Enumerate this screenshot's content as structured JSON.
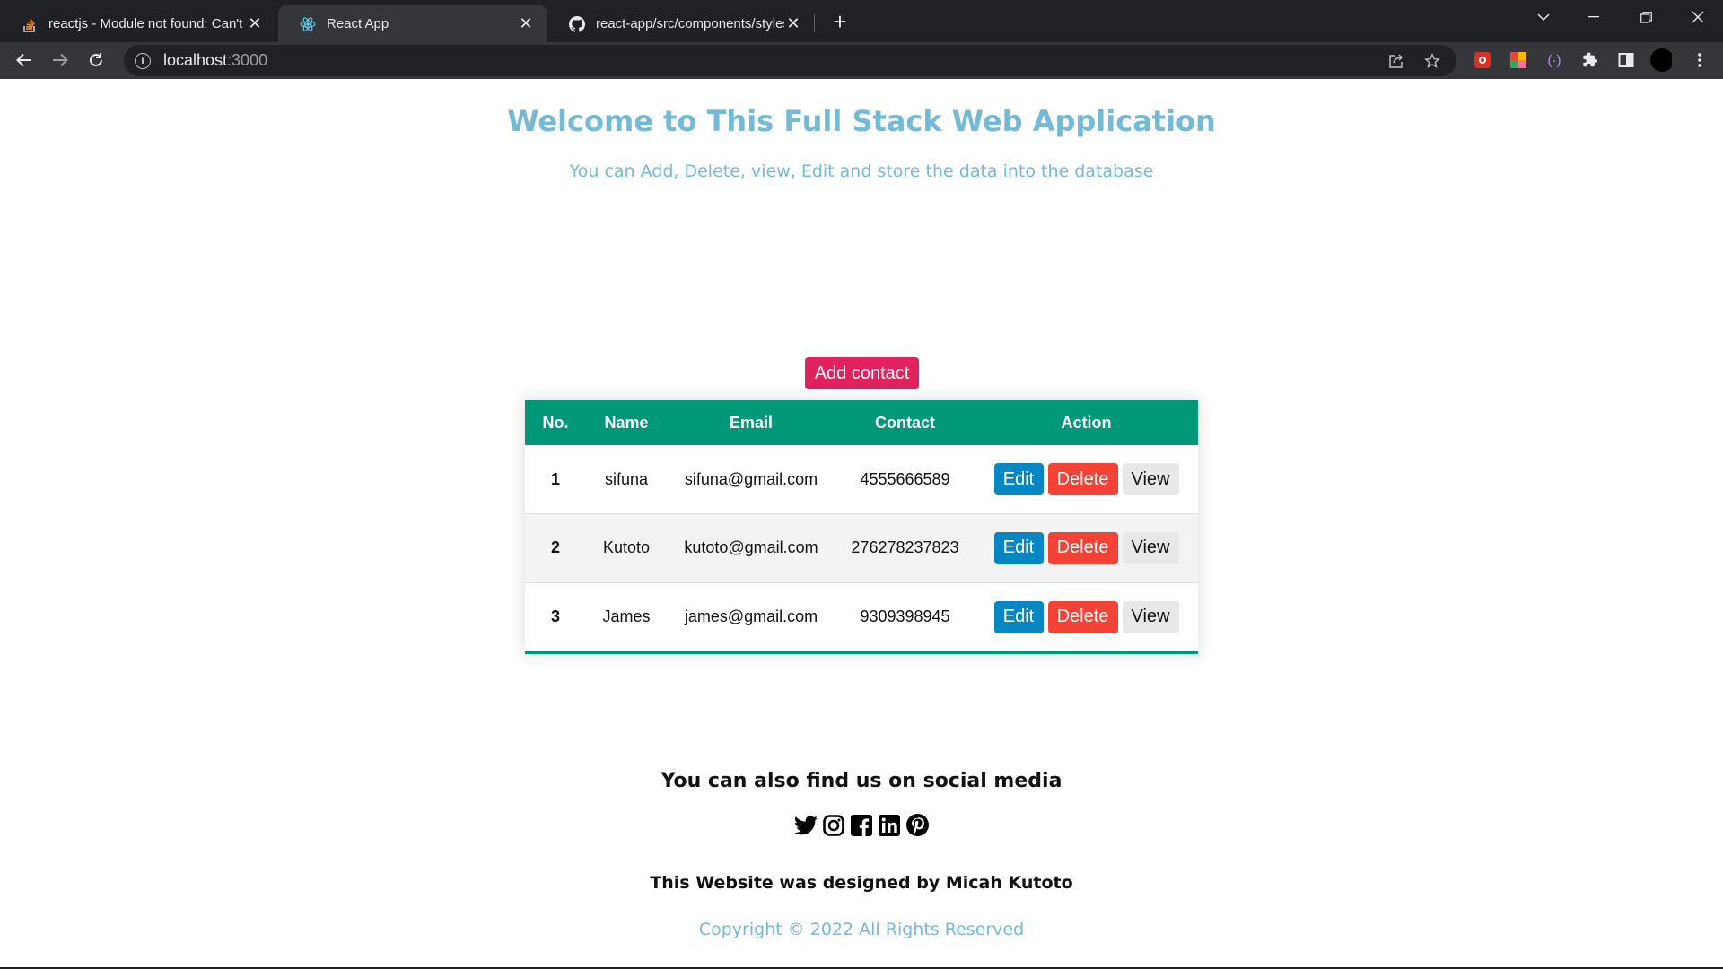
{
  "browser": {
    "tabs": [
      {
        "title": "reactjs - Module not found: Can't resolve",
        "icon": "stackoverflow-icon",
        "active": false
      },
      {
        "title": "React App",
        "icon": "react-icon",
        "active": true
      },
      {
        "title": "react-app/src/components/styles",
        "icon": "github-icon",
        "active": false
      }
    ],
    "url_host": "localhost",
    "url_port": ":3000"
  },
  "page": {
    "title": "Welcome to This Full Stack Web Application",
    "subtitle": "You can Add, Delete, view, Edit and store the data into the database",
    "add_button": "Add contact",
    "table": {
      "headers": [
        "No.",
        "Name",
        "Email",
        "Contact",
        "Action"
      ],
      "rows": [
        {
          "no": "1",
          "name": "sifuna",
          "email": "sifuna@gmail.com",
          "contact": "4555666589"
        },
        {
          "no": "2",
          "name": "Kutoto",
          "email": "kutoto@gmail.com",
          "contact": "276278237823"
        },
        {
          "no": "3",
          "name": "James",
          "email": "james@gmail.com",
          "contact": "9309398945"
        }
      ],
      "actions": {
        "edit": "Edit",
        "delete": "Delete",
        "view": "View"
      }
    },
    "social_title": "You can also find us on social media",
    "social_icons": [
      "twitter-icon",
      "instagram-icon",
      "facebook-icon",
      "linkedin-icon",
      "pinterest-icon"
    ],
    "designed_by": "This Website was designed by Micah Kutoto",
    "copyright": "Copyright © 2022 All Rights Reserved"
  },
  "colors": {
    "accent_title": "#74b9d6",
    "table_header": "#009879",
    "add_button": "#e2225d",
    "edit_button": "#0787c2",
    "delete_button": "#f44336"
  }
}
